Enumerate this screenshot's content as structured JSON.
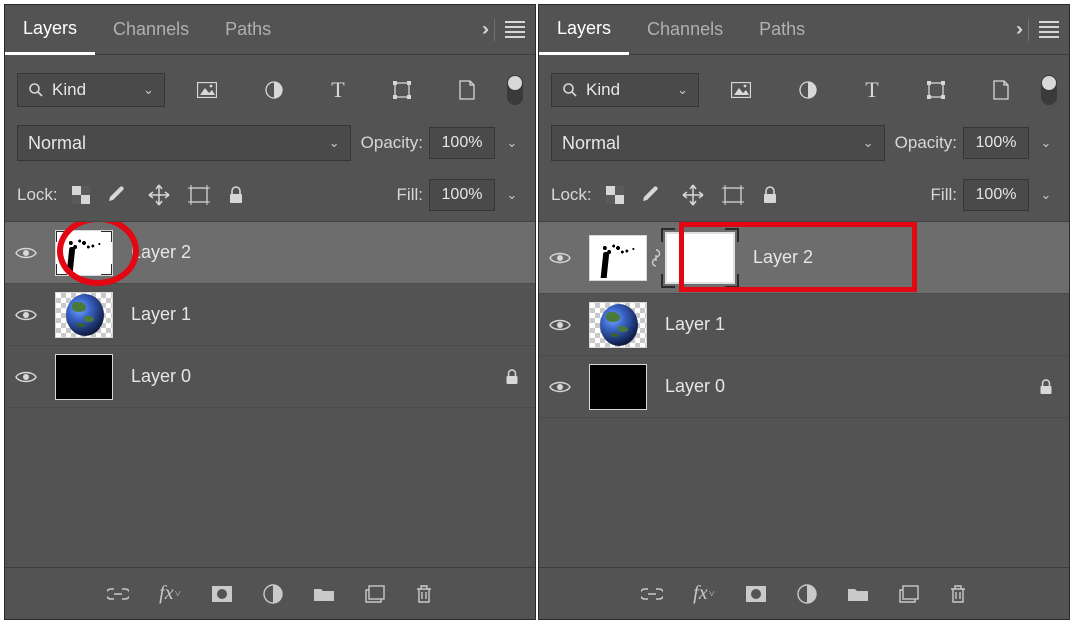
{
  "tabs": {
    "layers": "Layers",
    "channels": "Channels",
    "paths": "Paths"
  },
  "filter": {
    "kind": "Kind"
  },
  "blend": {
    "mode": "Normal",
    "opacity_label": "Opacity:",
    "opacity_value": "100%"
  },
  "lock": {
    "label": "Lock:",
    "fill_label": "Fill:",
    "fill_value": "100%"
  },
  "layers": {
    "l2": "Layer 2",
    "l1": "Layer 1",
    "l0": "Layer 0"
  }
}
